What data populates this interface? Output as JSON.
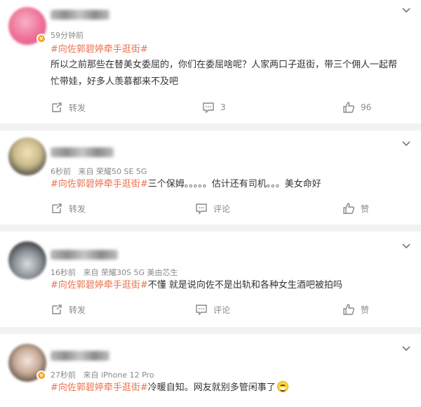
{
  "comments": [
    {
      "time": "59分钟前",
      "source": "",
      "topic": "#向佐郭碧婷牵手逛街#",
      "text_line1": "所以之前那些在替美女委屈的，你们在委屈啥呢？人家两口子逛街，带三个佣人一起帮",
      "text_line2": "忙带娃，好多人羡慕都来不及吧",
      "repost": "转发",
      "comment": "3",
      "like": "96"
    },
    {
      "time": "6秒前",
      "source": "来自 荣耀50 SE 5G",
      "topic": "#向佐郭碧婷牵手逛街#",
      "text": "三个保姆。。。。。估计还有司机。。。美女命好",
      "repost": "转发",
      "comment": "评论",
      "like": "赞"
    },
    {
      "time": "16秒前",
      "source": "来自 荣耀30S 5G 美由芯生",
      "topic": "#向佐郭碧婷牵手逛街#",
      "text": "不懂 就是说向佐不是出轨和各种女生酒吧被拍吗",
      "repost": "转发",
      "comment": "评论",
      "like": "赞"
    },
    {
      "time": "27秒前",
      "source": "来自 iPhone 12 Pro",
      "topic": "#向佐郭碧婷牵手逛街#",
      "text": "冷暖自知。网友就别多管闲事了",
      "emoji": "grinning-sweat-emoji"
    }
  ],
  "colors": {
    "topic": "#eb7350",
    "meta": "#8a8a8a",
    "text": "#333333",
    "badge": "#f5a623"
  },
  "icons": [
    "chevron-down-icon",
    "repost-icon",
    "comment-icon",
    "like-icon",
    "verified-badge-icon"
  ]
}
